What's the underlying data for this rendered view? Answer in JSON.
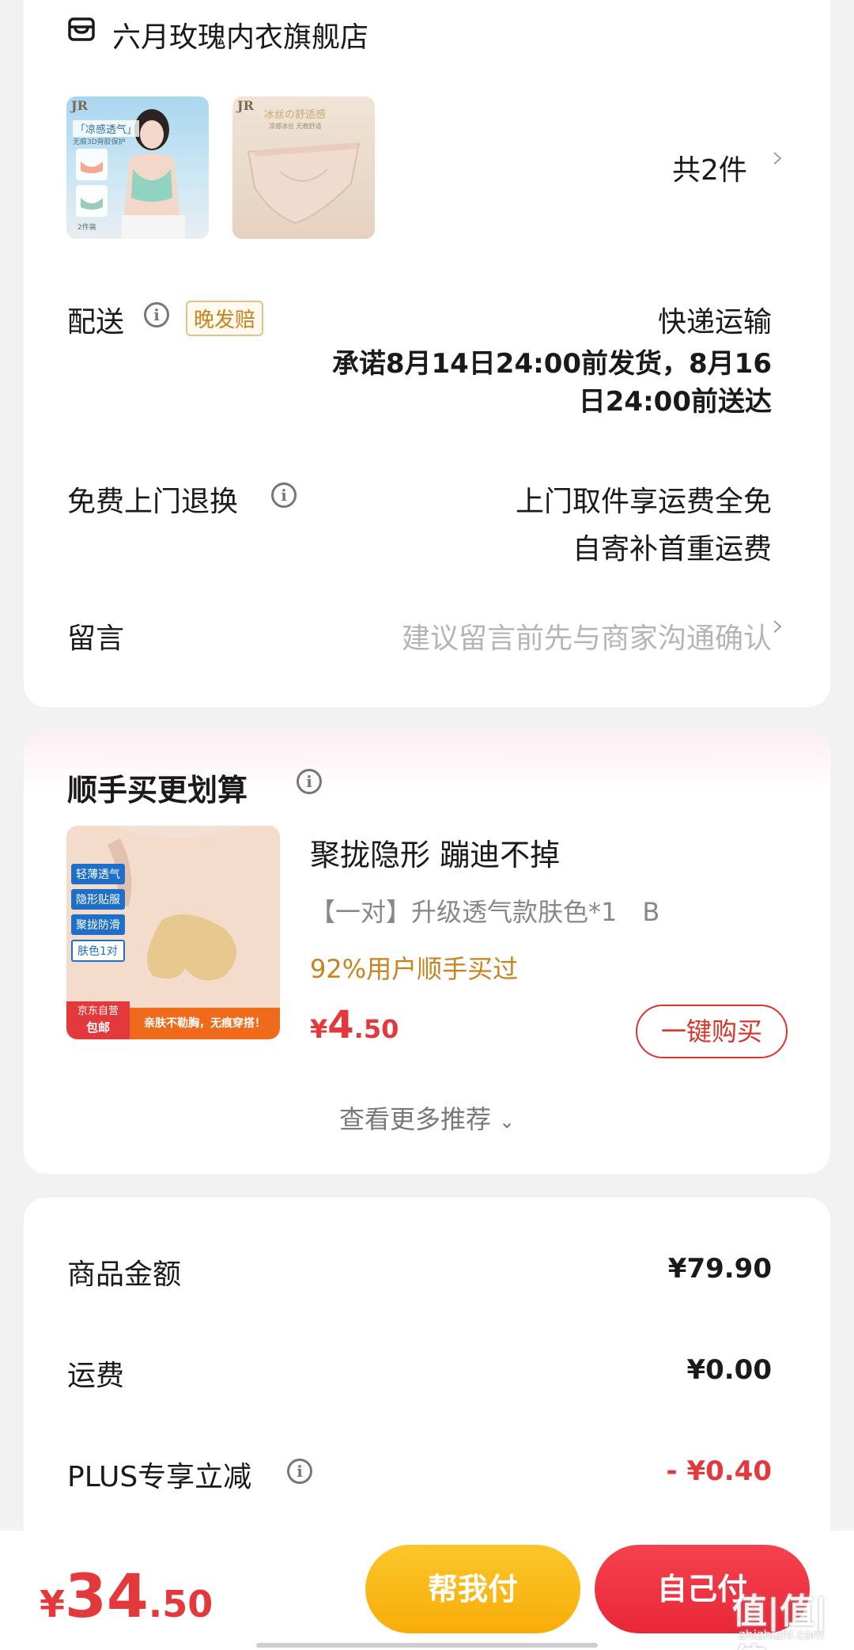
{
  "store": {
    "name": "六月玫瑰内衣旗舰店",
    "icon": "store-icon",
    "count_label": "共2件",
    "thumbs": [
      {
        "brand": "JR",
        "caption_top": "「凉感透气」",
        "caption_sub": "无痕3D背胶保护",
        "tag": "2件装"
      },
      {
        "brand": "JR",
        "caption_top": "冰丝の舒适感",
        "caption_sub": "凉感冰丝 无痕舒适"
      }
    ]
  },
  "delivery": {
    "label": "配送",
    "badge": "晚发赔",
    "method": "快递运输",
    "promise_line1": "承诺8月14日24:00前发货，8月16",
    "promise_line2": "日24:00前送达"
  },
  "returns": {
    "label": "免费上门退换",
    "line1": "上门取件享运费全免",
    "line2": "自寄补首重运费"
  },
  "message": {
    "label": "留言",
    "placeholder": "建议留言前先与商家沟通确认"
  },
  "addon": {
    "title": "顺手买更划算",
    "product_title": "聚拢隐形 蹦迪不掉",
    "spec": "【一对】升级透气款肤色*1　B",
    "social_proof": "92%用户顺手买过",
    "price_symbol": "¥",
    "price_int": "4",
    "price_dec": ".50",
    "buy_button": "一键购买",
    "more_link": "查看更多推荐",
    "image_tags": [
      "轻薄透气",
      "隐形贴服",
      "聚拢防滑",
      "肤色1对"
    ],
    "image_badge_top": "京东自营",
    "image_badge_bottom": "包邮",
    "image_banner": "亲肤不勒胸，无痕穿搭！"
  },
  "summary": {
    "rows": [
      {
        "label": "商品金额",
        "value": "¥79.90"
      },
      {
        "label": "运费",
        "value": "¥0.00"
      },
      {
        "label": "PLUS专享立减",
        "value": "- ¥0.40"
      }
    ]
  },
  "bottom": {
    "price_symbol": "¥",
    "price_int": "34",
    "price_dec": ".50",
    "help_pay": "帮我付",
    "self_pay": "自己付",
    "watermark_main": "值|值|值",
    "watermark_sub": "zhizhizhi.com"
  },
  "colors": {
    "red": "#e4393c",
    "orange_text": "#c8821e",
    "yellow_btn": "#fbbd13",
    "red_btn": "#f0303e"
  }
}
